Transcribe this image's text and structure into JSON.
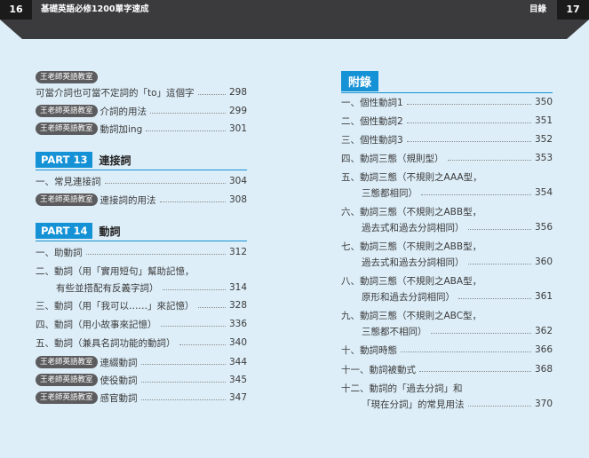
{
  "header": {
    "left_page_number": "16",
    "left_title": "基礎英語必修1200單字速成",
    "right_title": "目錄",
    "right_page_number": "17"
  },
  "left_column": {
    "badge_label": "王老師英語教室",
    "rows_top": [
      {
        "text": "可當介詞也可當不定詞的「to」這個字",
        "page": "298",
        "badge": false
      },
      {
        "text": "介詞的用法",
        "page": "299",
        "badge": true
      },
      {
        "text": "動詞加ing",
        "page": "301",
        "badge": true
      }
    ],
    "part13": {
      "tag": "PART 13",
      "title": "連接詞"
    },
    "rows_part13": [
      {
        "text": "一、常見連接詞",
        "page": "304",
        "badge": false
      },
      {
        "text": "連接詞的用法",
        "page": "308",
        "badge": true
      }
    ],
    "part14": {
      "tag": "PART 14",
      "title": "動詞"
    },
    "rows_part14": [
      {
        "text": "一、助動詞",
        "page": "312"
      },
      {
        "text": "二、動詞（用「實用短句」幫助記憶，",
        "page": ""
      },
      {
        "text": "有些並搭配有反義字詞）",
        "page": "314"
      },
      {
        "text": "三、動詞（用「我可以……」來記憶）",
        "page": "328"
      },
      {
        "text": "四、動詞（用小故事來記憶）",
        "page": "336"
      },
      {
        "text": "五、動詞（兼具名詞功能的動詞）",
        "page": "340"
      },
      {
        "text": "連綴動詞",
        "page": "344"
      },
      {
        "text": "使役動詞",
        "page": "345"
      },
      {
        "text": "感官動詞",
        "page": "347"
      }
    ]
  },
  "right_column": {
    "appendix_label": "附錄",
    "rows": [
      {
        "text": "一、個性動詞1",
        "page": "350"
      },
      {
        "text": "二、個性動詞2",
        "page": "351"
      },
      {
        "text": "三、個性動詞3",
        "page": "352"
      },
      {
        "text": "四、動詞三態（規則型）",
        "page": "353"
      },
      {
        "text": "五、動詞三態（不規則之AAA型，",
        "page": ""
      },
      {
        "text": "三態都相同）",
        "page": "354"
      },
      {
        "text": "六、動詞三態（不規則之ABB型，",
        "page": ""
      },
      {
        "text": "過去式和過去分詞相同）",
        "page": "356"
      },
      {
        "text": "七、動詞三態（不規則之ABB型，",
        "page": ""
      },
      {
        "text": "過去式和過去分詞相同）",
        "page": "360"
      },
      {
        "text": "八、動詞三態（不規則之ABA型，",
        "page": ""
      },
      {
        "text": "原形和過去分詞相同）",
        "page": "361"
      },
      {
        "text": "九、動詞三態（不規則之ABC型，",
        "page": ""
      },
      {
        "text": "三態都不相同）",
        "page": "362"
      },
      {
        "text": "十、動詞時態",
        "page": "366"
      },
      {
        "text": "十一、動詞被動式",
        "page": "368"
      },
      {
        "text": "十二、動詞的「過去分詞」和",
        "page": ""
      },
      {
        "text": "「現在分詞」的常見用法",
        "page": "370"
      }
    ]
  },
  "colors": {
    "accent": "#1592d6",
    "header_bar": "#3b3b3d",
    "background": "#ddeef8"
  }
}
